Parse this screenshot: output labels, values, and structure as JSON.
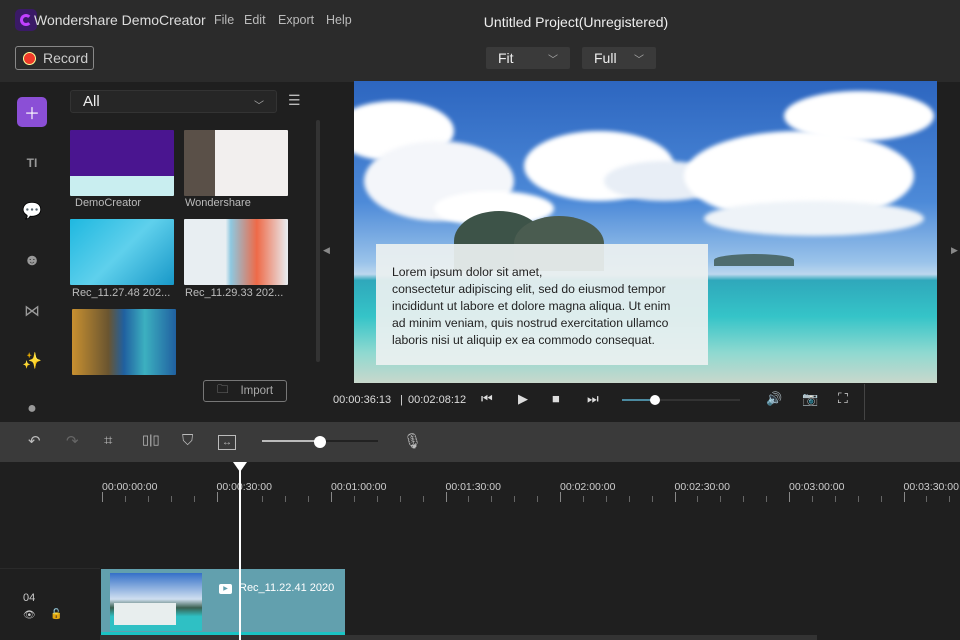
{
  "app": {
    "name": "Wondershare DemoCreator",
    "title": "Untitled Project(Unregistered)"
  },
  "menu": [
    "File",
    "Edit",
    "Export",
    "Help"
  ],
  "record_label": "Record",
  "fit_select": "Fit",
  "quality_select": "Full",
  "media": {
    "filter": "All",
    "import_label": "Import",
    "items": [
      {
        "label": "DemoCreator"
      },
      {
        "label": "Wondershare"
      },
      {
        "label": "Rec_11.27.48 202..."
      },
      {
        "label": "Rec_11.29.33 202..."
      },
      {
        "label": ""
      }
    ]
  },
  "preview": {
    "text_lines": [
      "Lorem ipsum dolor sit amet,",
      "consectetur adipiscing elit, sed do eiusmod tempor",
      "incididunt ut labore et dolore magna aliqua. Ut enim",
      "ad minim veniam, quis nostrud exercitation ullamco",
      "laboris nisi ut aliquip ex ea commodo consequat."
    ],
    "current_time": "00:00:36:13",
    "separator": "|",
    "total_time": "00:02:08:12",
    "progress": 0.28
  },
  "toolbar": {
    "zoom_level": 0.5
  },
  "timeline": {
    "ticks": [
      "00:00:00:00",
      "00:00:30:00",
      "00:01:00:00",
      "00:01:30:00",
      "00:02:00:00",
      "00:02:30:00",
      "00:03:00:00",
      "00:03:30:00"
    ],
    "track_number": "04",
    "clip_name": "Rec_11.22.41 2020"
  },
  "colors": {
    "accent": "#8b4fd6",
    "record": "#f03a2a",
    "clip": "#62a0ae"
  }
}
